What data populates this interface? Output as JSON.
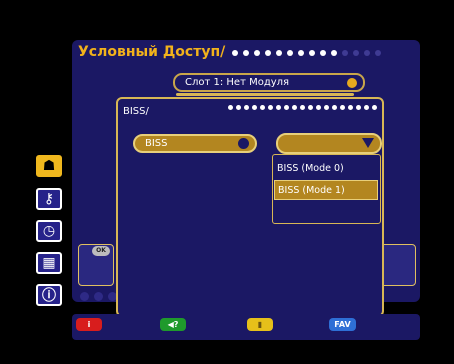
{
  "screen": {
    "title": "Условный Доступ/",
    "slot_label": "Слот 1: Нет Модуля",
    "ok_label": "OK"
  },
  "dialog": {
    "title": "BISS/",
    "field_label": "BISS",
    "options": [
      {
        "label": "BISS (Mode 0)",
        "selected": false
      },
      {
        "label": "BISS (Mode 1)",
        "selected": true
      }
    ]
  },
  "sidebar": {
    "items": [
      {
        "icon": "satellite-icon",
        "glyph": "☗",
        "active": true
      },
      {
        "icon": "key-icon",
        "glyph": "⚷",
        "active": false
      },
      {
        "icon": "clock-icon",
        "glyph": "◷",
        "active": false
      },
      {
        "icon": "recording-icon",
        "glyph": "▦",
        "active": false
      },
      {
        "icon": "info-icon",
        "glyph": "ⓘ",
        "active": false
      }
    ]
  },
  "color_keys": {
    "red": "i",
    "green": "◀?",
    "yellow": "▮",
    "blue": "FAV"
  },
  "colors": {
    "panel": "#1b1864",
    "accent": "#b38620",
    "title": "#f2b21b"
  }
}
